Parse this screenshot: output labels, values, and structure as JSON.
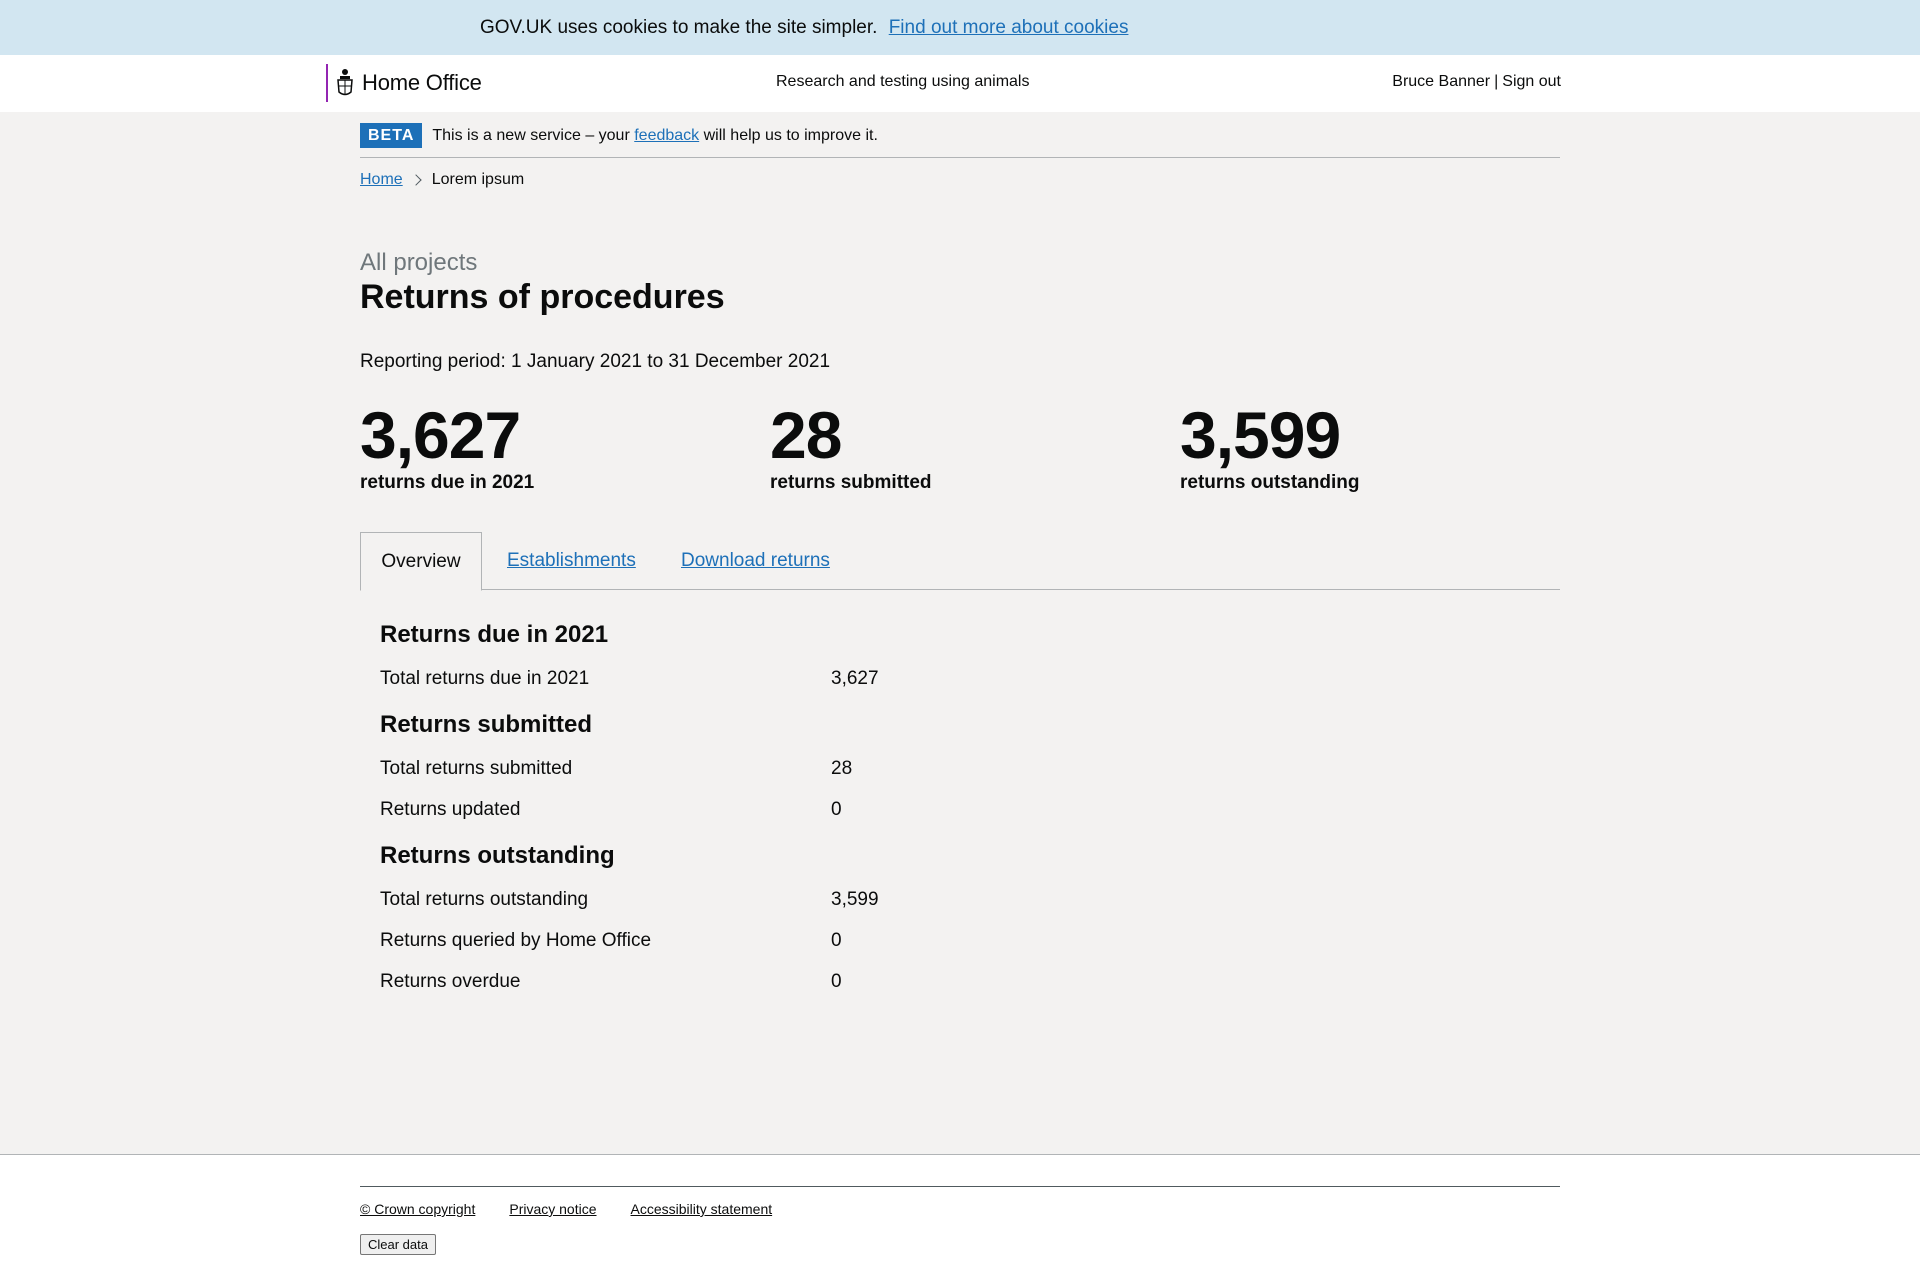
{
  "cookie_banner": {
    "text": "GOV.UK uses cookies to make the site simpler.",
    "link": "Find out more about cookies"
  },
  "header": {
    "brand": "Home Office",
    "service_name": "Research and testing using animals",
    "user_name": "Bruce Banner",
    "separator": "|",
    "sign_out": "Sign out"
  },
  "phase_banner": {
    "tag": "BETA",
    "text_before": "This is a new service – your",
    "link": "feedback",
    "text_after": "will help us to improve it."
  },
  "breadcrumbs": {
    "home": "Home",
    "current": "Lorem ipsum"
  },
  "page": {
    "caption": "All projects",
    "title": "Returns of procedures",
    "reporting_period": "Reporting period: 1 January 2021 to 31 December 2021"
  },
  "stats": [
    {
      "value": "3,627",
      "label": "returns due in 2021"
    },
    {
      "value": "28",
      "label": "returns submitted"
    },
    {
      "value": "3,599",
      "label": "returns outstanding"
    }
  ],
  "tabs": [
    {
      "label": "Overview",
      "active": true
    },
    {
      "label": "Establishments",
      "active": false
    },
    {
      "label": "Download returns",
      "active": false
    }
  ],
  "overview": {
    "due": {
      "heading": "Returns due in 2021",
      "rows": [
        {
          "label": "Total returns due in 2021",
          "value": "3,627"
        }
      ]
    },
    "submitted": {
      "heading": "Returns submitted",
      "rows": [
        {
          "label": "Total returns submitted",
          "value": "28"
        },
        {
          "label": "Returns updated",
          "value": "0"
        }
      ]
    },
    "outstanding": {
      "heading": "Returns outstanding",
      "rows": [
        {
          "label": "Total returns outstanding",
          "value": "3,599"
        },
        {
          "label": "Returns queried by Home Office",
          "value": "0"
        },
        {
          "label": "Returns overdue",
          "value": "0"
        }
      ]
    }
  },
  "footer": {
    "links": [
      "© Crown copyright",
      "Privacy notice",
      "Accessibility statement"
    ],
    "clear_button": "Clear data"
  },
  "colors": {
    "link": "#1d70b8",
    "beta_tag": "#1d70b8",
    "cookie_background": "#d2e6f1",
    "page_background": "#f3f2f1",
    "brand_bar": "#9325b2"
  }
}
